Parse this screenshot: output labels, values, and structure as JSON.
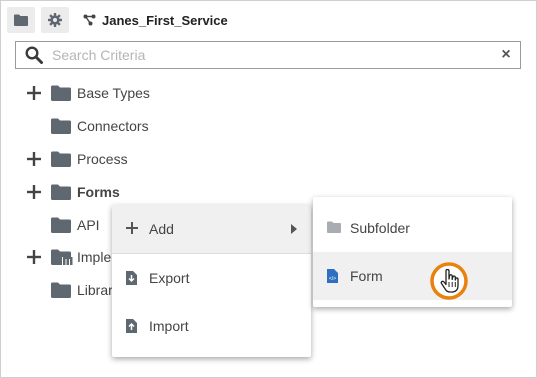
{
  "toolbar": {
    "folder_icon": "folder-icon",
    "settings_icon": "gear-icon",
    "service_icon": "service-icon",
    "service_name": "Janes_First_Service"
  },
  "search": {
    "placeholder": "Search Criteria",
    "value": "",
    "clear_label": "×"
  },
  "tree": {
    "items": [
      {
        "label": "Base Types",
        "expandable": true
      },
      {
        "label": "Connectors",
        "expandable": false
      },
      {
        "label": "Process",
        "expandable": true
      },
      {
        "label": "Forms",
        "expandable": true,
        "bold": true
      },
      {
        "label": "API",
        "expandable": false
      },
      {
        "label": "Imple",
        "expandable": true
      },
      {
        "label": "Librar",
        "expandable": false
      }
    ]
  },
  "context_menu": {
    "items": [
      {
        "label": "Add",
        "icon": "plus-icon",
        "has_submenu": true
      },
      {
        "label": "Export",
        "icon": "export-icon"
      },
      {
        "label": "Import",
        "icon": "import-icon"
      }
    ]
  },
  "submenu": {
    "items": [
      {
        "label": "Subfolder",
        "icon": "folder-icon"
      },
      {
        "label": "Form",
        "icon": "form-file-icon"
      }
    ]
  },
  "colors": {
    "folder": "#5f6770",
    "cursor_ring": "#e8820c",
    "form_icon": "#2f6fbf"
  }
}
